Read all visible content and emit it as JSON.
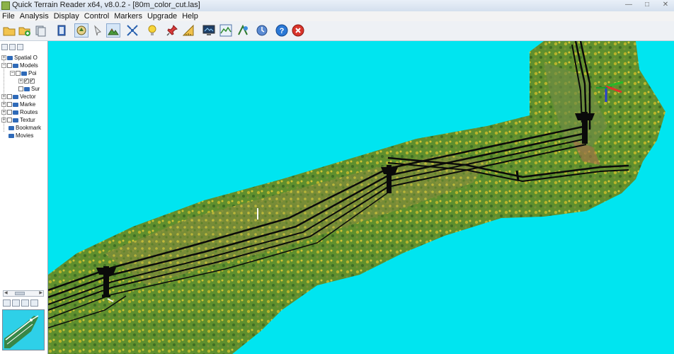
{
  "window": {
    "title": "Quick Terrain Reader x64, v8.0.2 - [80m_color_cut.las]",
    "controls": {
      "minimize": "—",
      "maximize": "□",
      "close": "✕"
    }
  },
  "menu": [
    "File",
    "Analysis",
    "Display",
    "Control",
    "Markers",
    "Upgrade",
    "Help"
  ],
  "toolbar": [
    {
      "name": "open-folder-icon"
    },
    {
      "name": "add-file-icon"
    },
    {
      "name": "layers-icon"
    },
    {
      "name": "book-icon"
    },
    {
      "name": "navigate-icon"
    },
    {
      "name": "select-icon"
    },
    {
      "name": "terrain-view-icon"
    },
    {
      "name": "zoom-extents-icon"
    },
    {
      "name": "lightbulb-icon"
    },
    {
      "name": "pushpin-icon"
    },
    {
      "name": "measure-icon"
    },
    {
      "name": "monitor-icon"
    },
    {
      "name": "profile-icon"
    },
    {
      "name": "marker-icon"
    },
    {
      "name": "refresh-icon"
    },
    {
      "name": "help-icon"
    },
    {
      "name": "stop-icon"
    }
  ],
  "tree": [
    {
      "label": "Spatial O",
      "level": 0
    },
    {
      "label": "Models",
      "level": 0
    },
    {
      "label": "Poi",
      "level": 1
    },
    {
      "label": "",
      "level": 2
    },
    {
      "label": "Sur",
      "level": 2
    },
    {
      "label": "Vector",
      "level": 0
    },
    {
      "label": "Marke",
      "level": 0
    },
    {
      "label": "Routes",
      "level": 0
    },
    {
      "label": "Textur",
      "level": 0
    },
    {
      "label": "Bookmark",
      "level": 0
    },
    {
      "label": "Movies",
      "level": 0
    }
  ],
  "colors": {
    "sky": "#00e5f0",
    "terrain_green": "#5a8a2e",
    "canopy_yellow": "#c8c22c",
    "powerline": "#0a0a0a"
  }
}
